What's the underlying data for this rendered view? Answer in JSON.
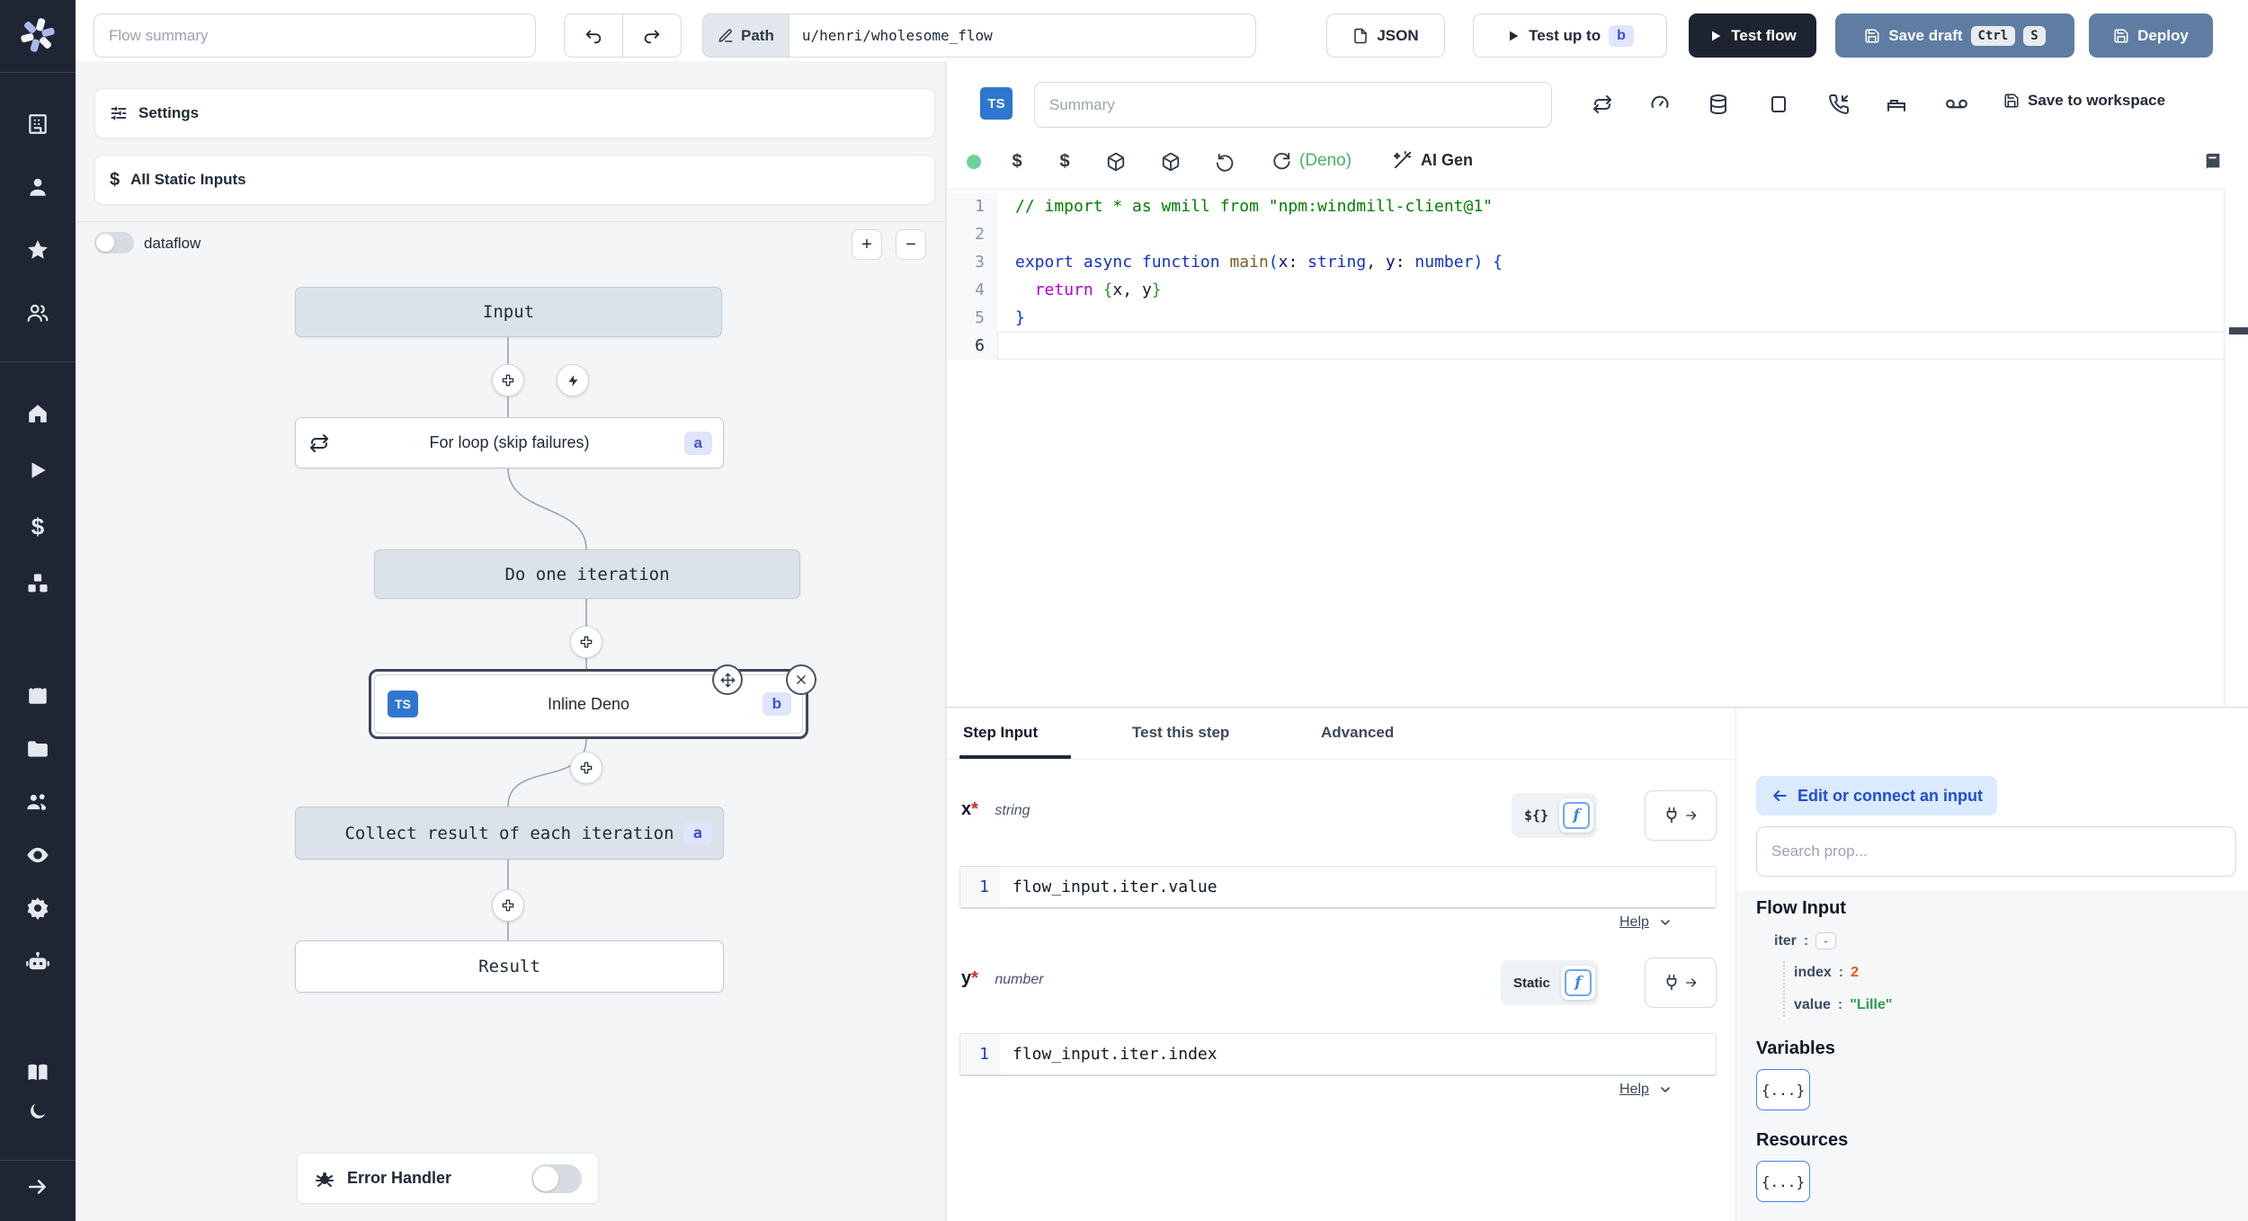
{
  "topbar": {
    "flow_summary_placeholder": "Flow summary",
    "path_label": "Path",
    "path_value": "u/henri/wholesome_flow",
    "json_button": "JSON",
    "test_up_to": "Test up to",
    "test_up_to_badge": "b",
    "test_flow": "Test flow",
    "save_draft": "Save draft",
    "kbd_ctrl": "Ctrl",
    "kbd_s": "S",
    "deploy": "Deploy"
  },
  "sidebar": {
    "icons": [
      "workspace",
      "user",
      "favorites",
      "users",
      "home",
      "runs",
      "variables",
      "resources",
      "schedules",
      "folders",
      "groups",
      "audit-logs",
      "settings",
      "ai",
      "docs",
      "dark-mode",
      "expand"
    ]
  },
  "flow_panel": {
    "settings": "Settings",
    "all_static_inputs": "All Static Inputs",
    "dataflow_label": "dataflow",
    "zoom_in": "+",
    "zoom_out": "−",
    "nodes": {
      "input": "Input",
      "for_loop": "For loop (skip failures)",
      "for_loop_badge": "a",
      "do_one_iteration": "Do one iteration",
      "inline_deno": "Inline Deno",
      "inline_deno_badge": "b",
      "inline_deno_lang": "TS",
      "collect": "Collect result of each iteration",
      "collect_badge": "a",
      "result": "Result"
    },
    "error_handler": "Error Handler"
  },
  "editor": {
    "lang_badge": "TS",
    "summary_placeholder": "Summary",
    "save_to_workspace": "Save to workspace",
    "deno_label": "(Deno)",
    "ai_gen": "AI Gen",
    "current_line": 6,
    "lines": [
      [
        {
          "t": "// import * as wmill from \"npm:windmill-client@1\"",
          "c": "cmt"
        }
      ],
      [],
      [
        {
          "t": "export ",
          "c": "kw"
        },
        {
          "t": "async ",
          "c": "kw"
        },
        {
          "t": "function ",
          "c": "kw"
        },
        {
          "t": "main",
          "c": "fn"
        },
        {
          "t": "(",
          "c": "b1"
        },
        {
          "t": "x",
          "c": "pr"
        },
        {
          "t": ": ",
          "c": "pl"
        },
        {
          "t": "string",
          "c": "kw"
        },
        {
          "t": ", ",
          "c": "pl"
        },
        {
          "t": "y",
          "c": "pr"
        },
        {
          "t": ": ",
          "c": "pl"
        },
        {
          "t": "number",
          "c": "kw"
        },
        {
          "t": ")",
          "c": "b1"
        },
        {
          "t": " ",
          "c": "pl"
        },
        {
          "t": "{",
          "c": "b1"
        }
      ],
      [
        {
          "t": "  ",
          "c": "pl"
        },
        {
          "t": "return",
          "c": "ret"
        },
        {
          "t": " ",
          "c": "pl"
        },
        {
          "t": "{",
          "c": "b2"
        },
        {
          "t": "x",
          "c": "pl"
        },
        {
          "t": ", ",
          "c": "pl"
        },
        {
          "t": "y",
          "c": "pl"
        },
        {
          "t": "}",
          "c": "b2"
        }
      ],
      [
        {
          "t": "}",
          "c": "b1"
        }
      ],
      []
    ]
  },
  "step_panel": {
    "tabs": [
      "Step Input",
      "Test this step",
      "Advanced"
    ],
    "fields": [
      {
        "name": "x",
        "required": "*",
        "type": "string",
        "toggle_label": "${}",
        "line_no": "1",
        "value": "flow_input.iter.value",
        "help": "Help"
      },
      {
        "name": "y",
        "required": "*",
        "type": "number",
        "toggle_label": "Static",
        "line_no": "1",
        "value": "flow_input.iter.index",
        "help": "Help"
      }
    ]
  },
  "connect_panel": {
    "edit_button": "Edit or connect an input",
    "search_placeholder": "Search prop...",
    "flow_input_title": "Flow Input",
    "tree": {
      "iter_key": "iter",
      "iter_value": "-",
      "index_key": "index",
      "index_value": "2",
      "value_key": "value",
      "value_value": "\"Lille\""
    },
    "variables_title": "Variables",
    "variables_button": "{...}",
    "resources_title": "Resources",
    "resources_button": "{...}"
  },
  "colors": {
    "sidebar_bg": "#1f2532",
    "steel_blue": "#5f7da3",
    "dark_button": "#1d2430",
    "badge_bg": "#e0e4fc",
    "badge_text": "#3f51d1",
    "ts_badge_blue": "#2e77d0",
    "deno_green": "#45b26b",
    "node_gray": "#dbe2e9"
  }
}
